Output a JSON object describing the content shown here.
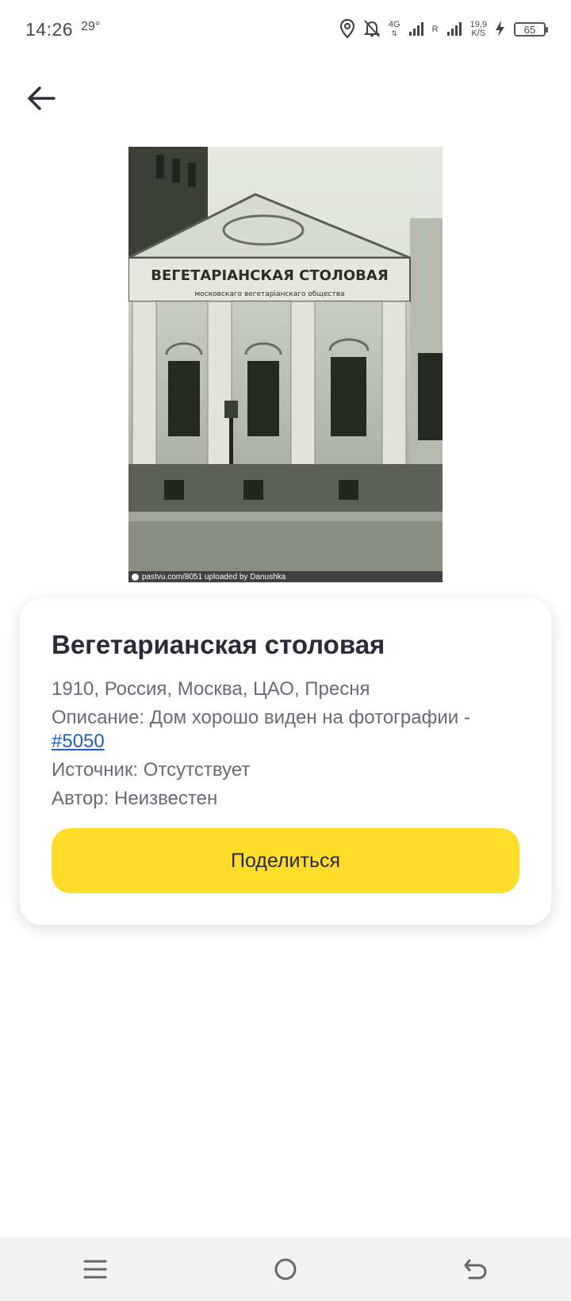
{
  "status_bar": {
    "time": "14:26",
    "temperature": "29°",
    "network_type": "4G",
    "roaming_label": "R",
    "speed_value": "19,9",
    "speed_unit": "K/S",
    "battery_level": "65"
  },
  "navigation": {
    "back_icon": "arrow-left-icon"
  },
  "photo": {
    "sign_main": "ВЕГЕТАРІАНСКАЯ СТОЛОВАЯ",
    "sign_sub": "московскаго вегетаріанскаго общества",
    "credit": "pastvu.com/8051  uploaded by Danushka"
  },
  "card": {
    "title": "Вегетарианская столовая",
    "meta": "1910, Россия, Москва, ЦАО, Пресня",
    "description_label": "Описание: Дом хорошо виден на фотографии -",
    "description_link": "#5050",
    "source": "Источник: Отсутствует",
    "author": "Автор: Неизвестен",
    "share_label": "Поделиться"
  },
  "nav_bar": {
    "menu_icon": "menu-icon",
    "home_icon": "home-circle-icon",
    "back_icon": "back-icon"
  },
  "colors": {
    "accent_button": "#fddc2a",
    "link": "#1f5fbf",
    "title_text": "#2a2a3c"
  }
}
